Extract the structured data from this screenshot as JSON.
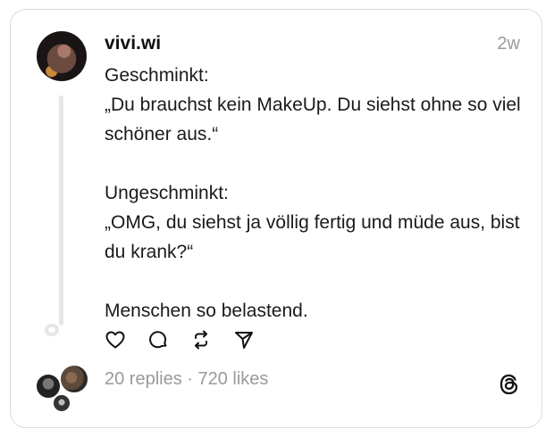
{
  "post": {
    "username": "vivi.wi",
    "time": "2w",
    "lines": [
      "Geschminkt:",
      "„Du brauchst kein MakeUp. Du siehst ohne so viel schöner aus.“",
      "",
      "Ungeschminkt:",
      "„OMG, du siehst ja völlig fertig und müde aus, bist du krank?“",
      "",
      "Menschen so belastend."
    ],
    "stats": "20 replies · 720 likes"
  },
  "icons": {
    "like": "heart-icon",
    "reply": "comment-icon",
    "repost": "repost-icon",
    "share": "send-icon",
    "brand": "threads-logo-icon"
  }
}
